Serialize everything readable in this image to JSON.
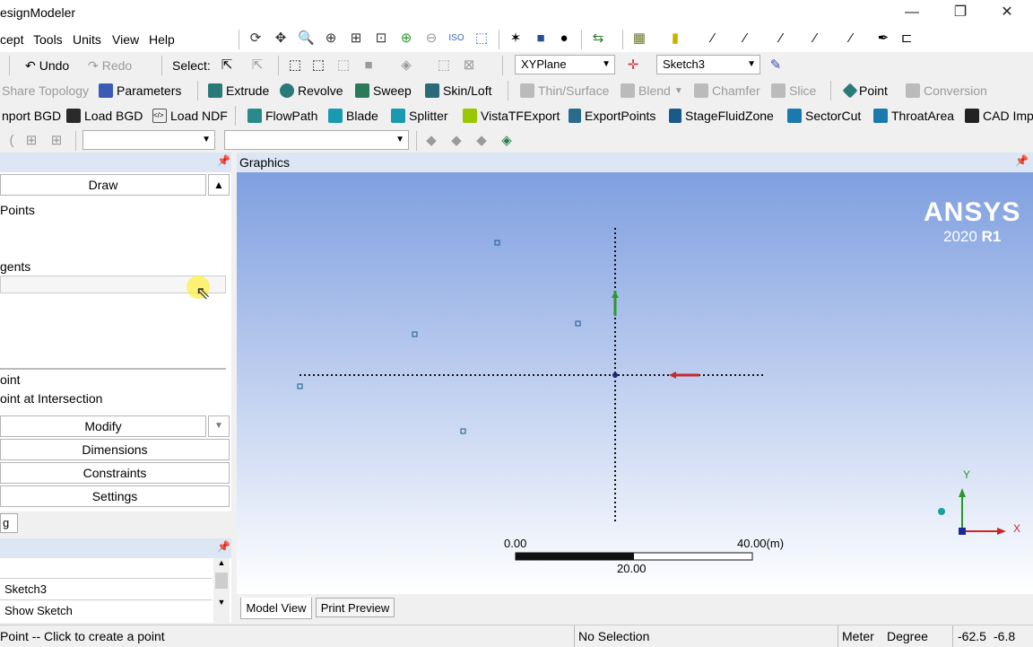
{
  "window": {
    "title": "esignModeler",
    "minimize": "—",
    "restore": "❐",
    "close": "✕"
  },
  "menu": [
    "cept",
    "Tools",
    "Units",
    "View",
    "Help"
  ],
  "toolbar1": {
    "undo": "Undo",
    "redo": "Redo",
    "select_label": "Select:",
    "plane": "XYPlane",
    "sketch": "Sketch3"
  },
  "toolbar2": {
    "share_topology": "Share Topology",
    "parameters": "Parameters",
    "extrude": "Extrude",
    "revolve": "Revolve",
    "sweep": "Sweep",
    "skin_loft": "Skin/Loft",
    "thin_surface": "Thin/Surface",
    "blend": "Blend",
    "chamfer": "Chamfer",
    "slice": "Slice",
    "point": "Point",
    "conversion": "Conversion"
  },
  "toolbar3": {
    "import_bgd": "nport BGD",
    "load_bgd": "Load BGD",
    "load_ndf": "Load NDF",
    "flowpath": "FlowPath",
    "blade": "Blade",
    "splitter": "Splitter",
    "vistatf": "VistaTFExport",
    "exportpoints": "ExportPoints",
    "stagefluid": "StageFluidZone",
    "sectorcut": "SectorCut",
    "throatarea": "ThroatArea",
    "cadimport": "CAD Impo"
  },
  "left_panel": {
    "draw": "Draw",
    "items": [
      "Points",
      "gents",
      "oint",
      "oint at Intersection"
    ],
    "modify": "Modify",
    "dimensions": "Dimensions",
    "constraints": "Constraints",
    "settings": "Settings",
    "tab": "g"
  },
  "details": {
    "row1": "Sketch3",
    "row2": "Show Sketch"
  },
  "graphics": {
    "header": "Graphics",
    "brand": "ANSYS",
    "version": "2020",
    "release": "R1",
    "scale_start": "0.00",
    "scale_end": "40.00",
    "scale_unit": "(m)",
    "scale_mid": "20.00",
    "axis_y": "Y",
    "axis_x": "X"
  },
  "tabs": {
    "model_view": "Model View",
    "print_preview": "Print Preview"
  },
  "status": {
    "hint": "Point -- Click to create a point",
    "selection": "No Selection",
    "unit": "Meter",
    "angle": "Degree",
    "coord1": "-62.5",
    "coord2": "-6.8"
  },
  "colors": {
    "accent": "#1a5a8a",
    "panel_header": "#dce6f4",
    "gfx_top": "#7f9fe0"
  }
}
